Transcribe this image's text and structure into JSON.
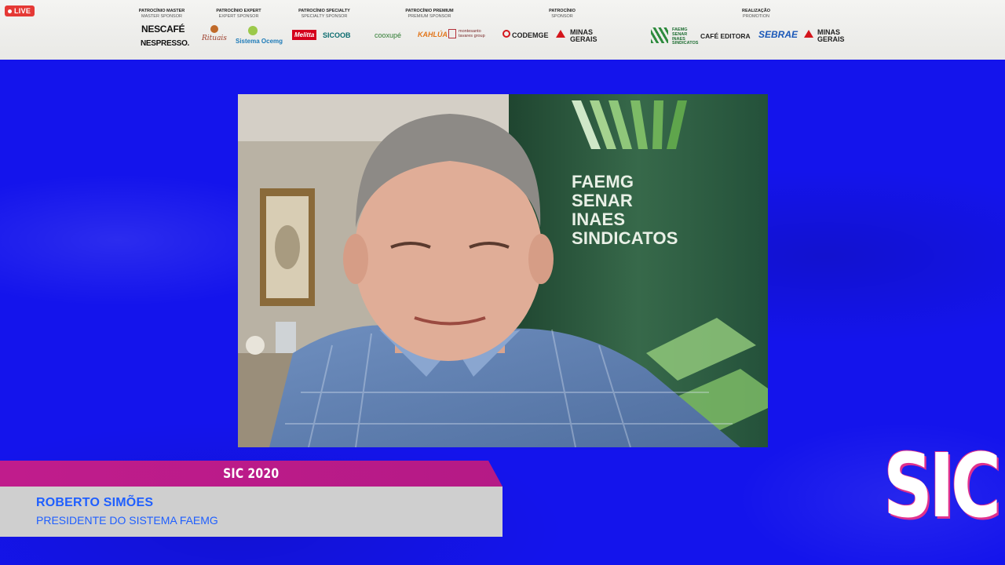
{
  "live": {
    "label": "LIVE"
  },
  "sponsors": {
    "master": {
      "label": "PATROCÍNIO MASTER",
      "sub": "MASTER SPONSOR",
      "logos": [
        "NESCAFÉ",
        "NESPRESSO."
      ]
    },
    "expert": {
      "label": "PATROCÍNIO EXPERT",
      "sub": "EXPERT SPONSOR",
      "logos": [
        "Rituais",
        "Sistema Ocemg"
      ]
    },
    "specialty": {
      "label": "PATROCÍNIO SPECIALTY",
      "sub": "SPECIALTY SPONSOR",
      "logos": [
        "Melitta",
        "SICOOB",
        "cooxupé",
        "KAHLÚA",
        "montesanto tavares group"
      ]
    },
    "premium": {
      "label": "PATROCÍNIO PREMIUM",
      "sub": "PREMIUM SPONSOR"
    },
    "sponsor": {
      "label": "PATROCÍNIO",
      "sub": "SPONSOR",
      "logos": [
        "CODEMGE",
        "MINAS GERAIS"
      ]
    },
    "promotion": {
      "label": "REALIZAÇÃO",
      "sub": "PROMOTION",
      "logos": [
        "FAEMG SENAR INAES SINDICATOS",
        "CAFÉ EDITORA",
        "SEBRAE",
        "MINAS GERAIS"
      ]
    }
  },
  "video": {
    "banner_lines": [
      "FAEMG",
      "SENAR",
      "INAES",
      "SINDICATOS"
    ]
  },
  "lower_third": {
    "event": "SIC 2020",
    "name": "ROBERTO SIMÕES",
    "role": "PRESIDENTE DO SISTEMA FAEMG"
  },
  "brand": {
    "mark": "SIC"
  },
  "colors": {
    "background_blue": "#1414ec",
    "magenta": "#c01c8c",
    "name_blue": "#1f5fff",
    "live_red": "#e53935"
  }
}
